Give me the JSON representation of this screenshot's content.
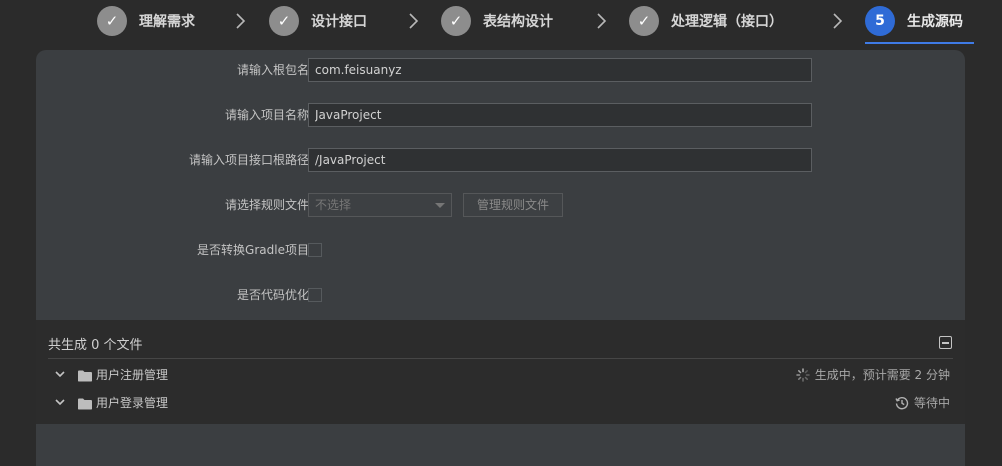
{
  "steps": [
    {
      "label": "理解需求",
      "state": "done",
      "icon": "check-icon"
    },
    {
      "label": "设计接口",
      "state": "done",
      "icon": "check-icon"
    },
    {
      "label": "表结构设计",
      "state": "done",
      "icon": "check-icon"
    },
    {
      "label": "处理逻辑（接口）",
      "state": "done",
      "icon": "check-icon"
    },
    {
      "label": "生成源码",
      "state": "active",
      "number": "5"
    }
  ],
  "form": {
    "package_label": "请输入根包名:",
    "package_value": "com.feisuanyz",
    "project_name_label": "请输入项目名称:",
    "project_name_value": "JavaProject",
    "root_path_label": "请输入项目接口根路径:",
    "root_path_value": "/JavaProject",
    "rule_file_label": "请选择规则文件:",
    "rule_file_placeholder": "不选择",
    "manage_rules_button": "管理规则文件",
    "gradle_label": "是否转换Gradle项目:",
    "gradle_checked": false,
    "optimize_label": "是否代码优化:",
    "optimize_checked": false
  },
  "files": {
    "summary": "共生成 0 个文件",
    "items": [
      {
        "name": "用户注册管理",
        "status": "生成中，预计需要 2 分钟",
        "status_icon": "loading-spinner-icon"
      },
      {
        "name": "用户登录管理",
        "status": "等待中",
        "status_icon": "history-clock-icon"
      }
    ]
  },
  "colors": {
    "active_step": "#2f6bd6",
    "done_step": "#8d8d8d",
    "panel_bg": "#3b3e41",
    "page_bg": "#2b2b2b"
  }
}
